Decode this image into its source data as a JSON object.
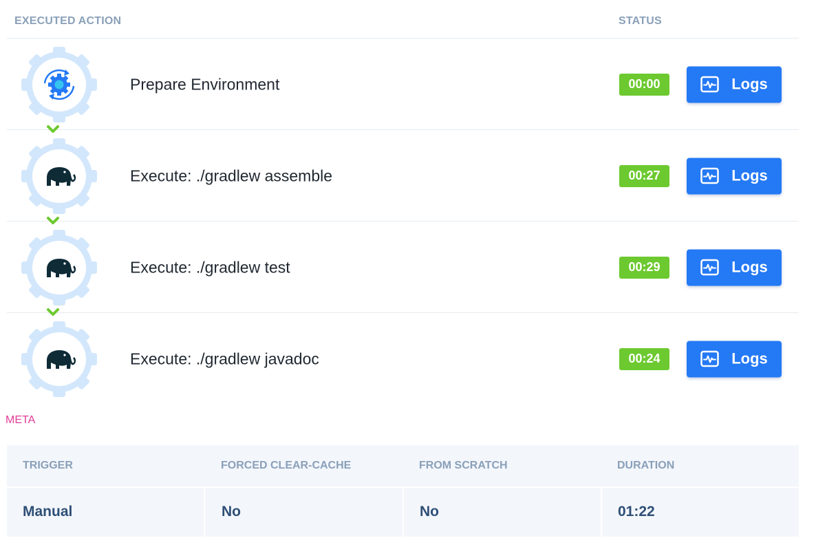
{
  "header": {
    "action_col": "EXECUTED ACTION",
    "status_col": "STATUS"
  },
  "actions": [
    {
      "title": "Prepare Environment",
      "duration": "00:00",
      "logs_label": "Logs",
      "icon": "gear-sync-icon"
    },
    {
      "title": "Execute: ./gradlew assemble",
      "duration": "00:27",
      "logs_label": "Logs",
      "icon": "gradle-elephant-icon"
    },
    {
      "title": "Execute: ./gradlew test",
      "duration": "00:29",
      "logs_label": "Logs",
      "icon": "gradle-elephant-icon"
    },
    {
      "title": "Execute: ./gradlew javadoc",
      "duration": "00:24",
      "logs_label": "Logs",
      "icon": "gradle-elephant-icon"
    }
  ],
  "connector_icon": "chevron-down-icon",
  "meta": {
    "label": "META",
    "columns": [
      {
        "header": "TRIGGER",
        "value": "Manual"
      },
      {
        "header": "FORCED CLEAR-CACHE",
        "value": "No"
      },
      {
        "header": "FROM SCRATCH",
        "value": "No"
      },
      {
        "header": "DURATION",
        "value": "01:22"
      }
    ]
  },
  "colors": {
    "badge_success": "#6cc92f",
    "button_primary": "#2479f5",
    "meta_accent": "#e23d98",
    "gear_ring": "#d3e7fc",
    "header_text": "#8aa0b9"
  }
}
